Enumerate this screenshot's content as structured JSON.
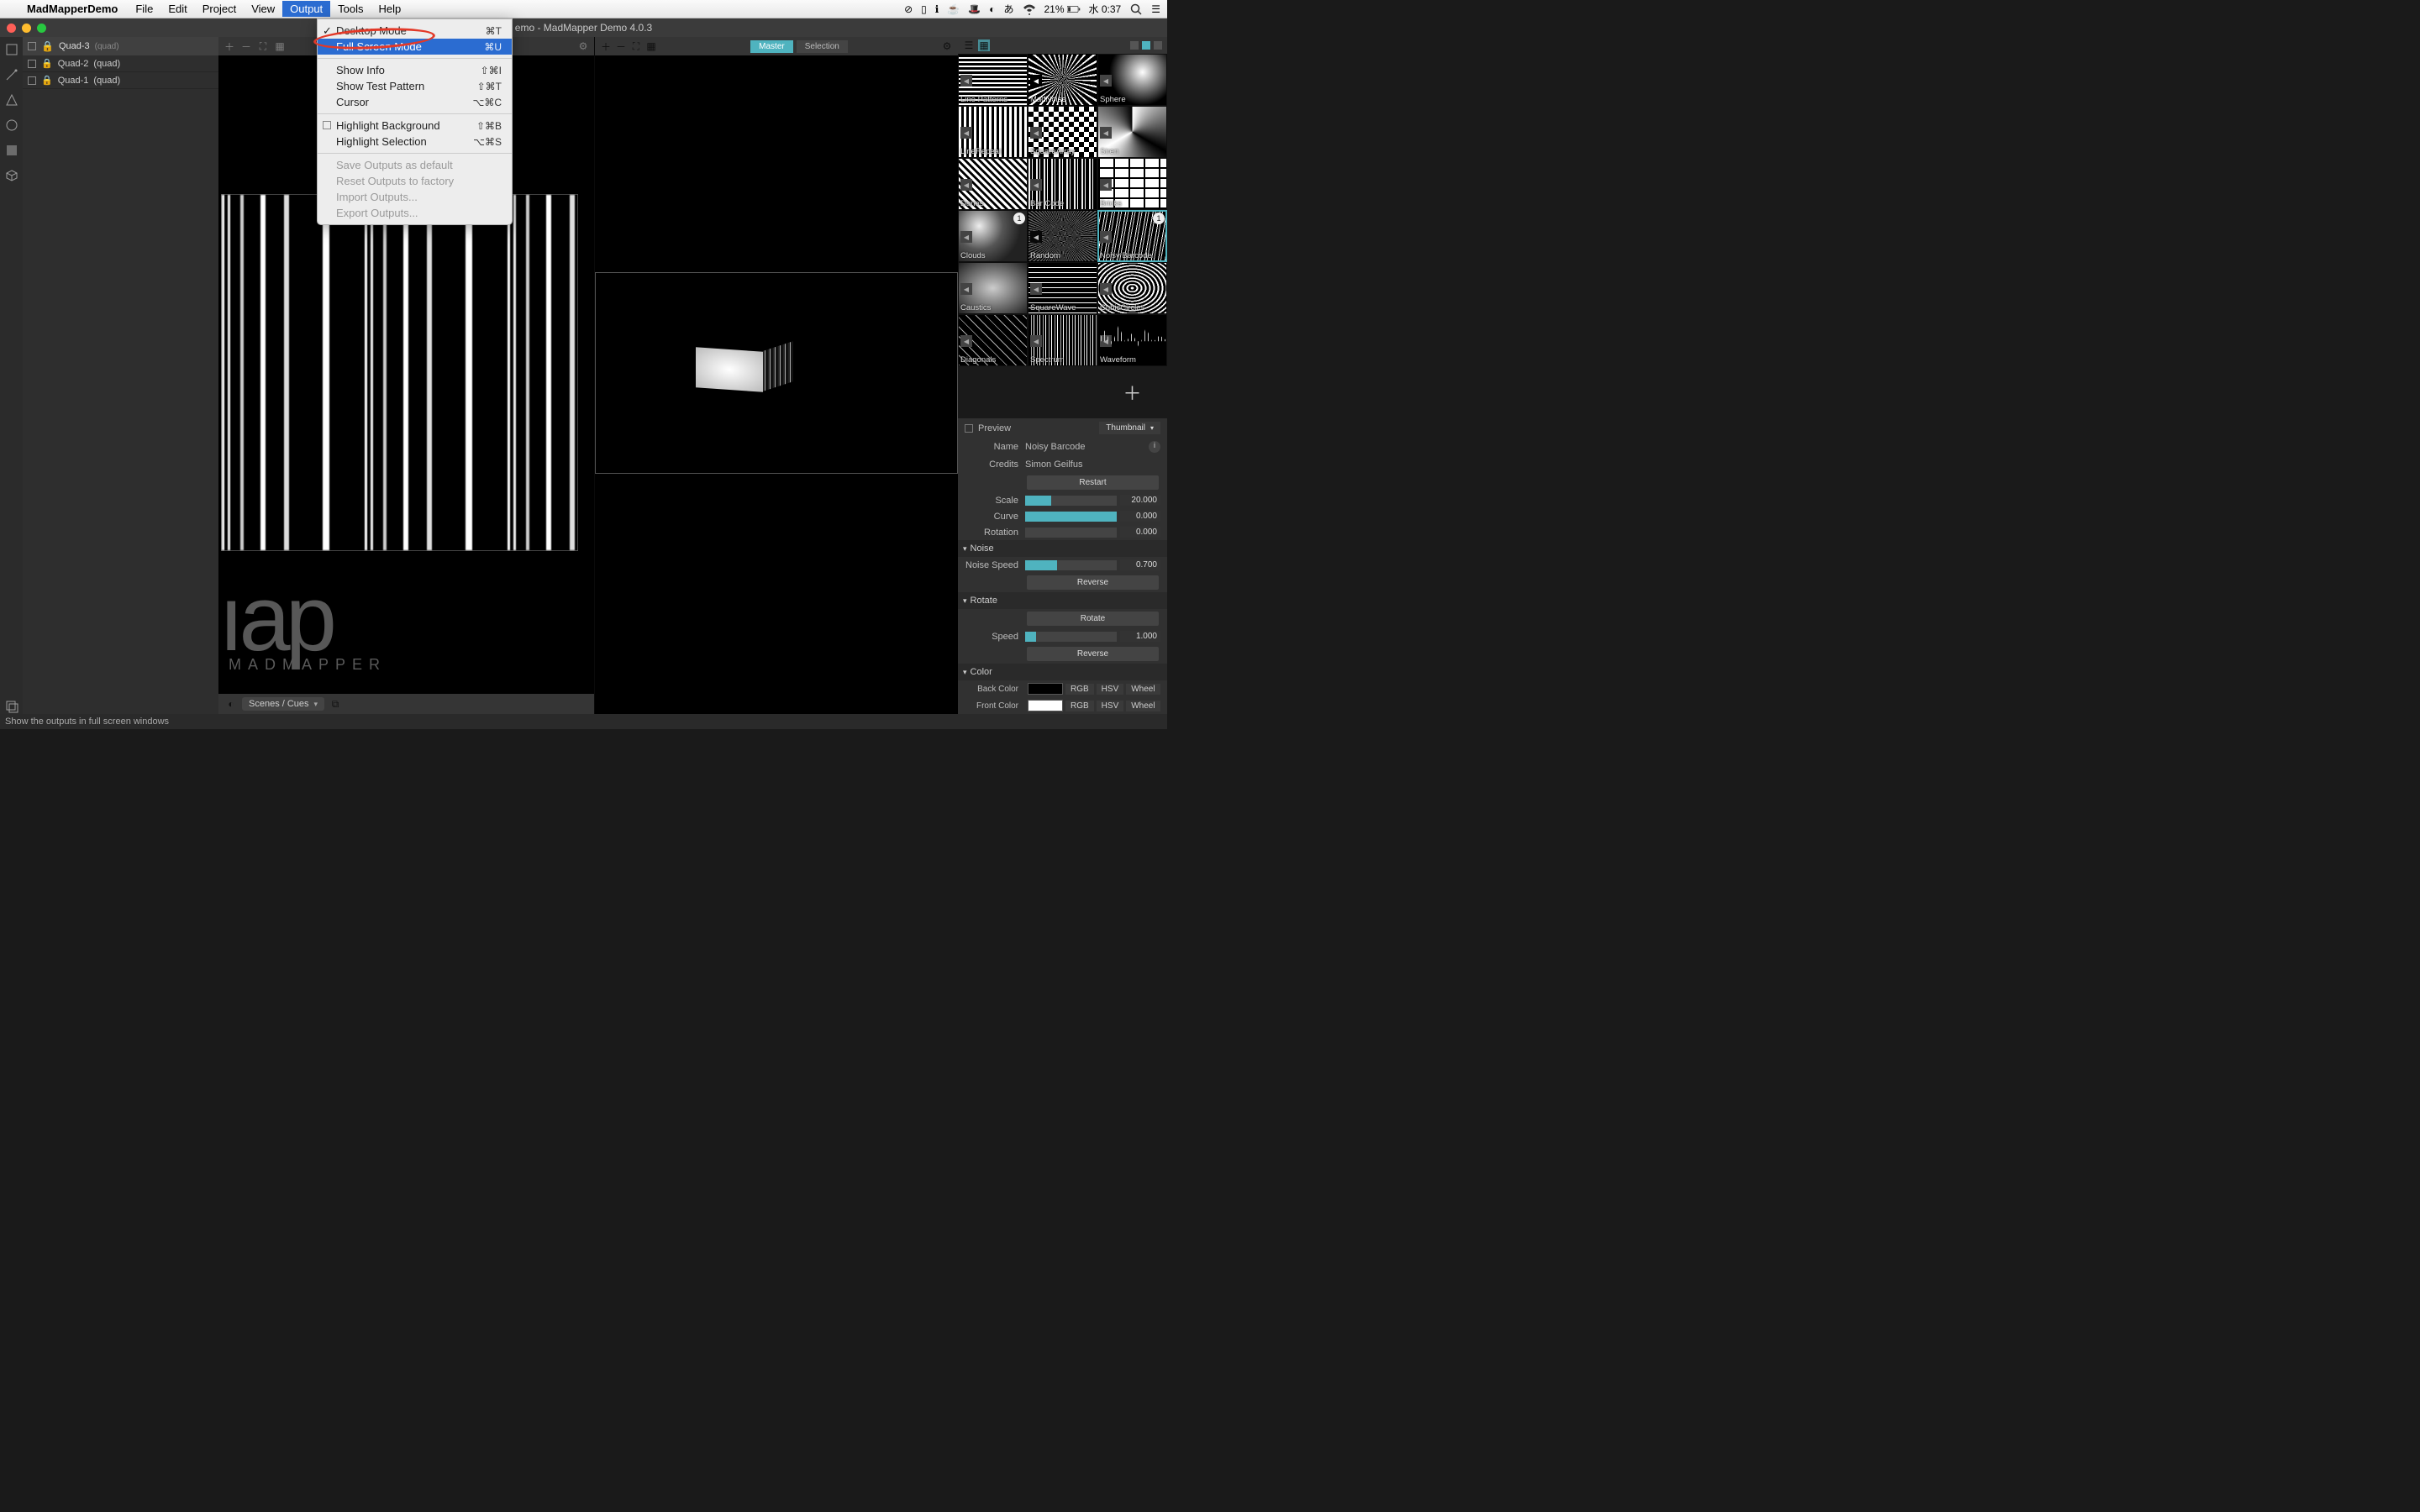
{
  "menubar": {
    "app": "MadMapperDemo",
    "items": [
      "File",
      "Edit",
      "Project",
      "View",
      "Output",
      "Tools",
      "Help"
    ],
    "open_index": 4,
    "right": {
      "battery": "21%",
      "clock": "水 0:37"
    }
  },
  "dropdown": {
    "groups": [
      [
        {
          "label": "Desktop Mode",
          "shortcut": "⌘T",
          "checked": true,
          "hover": false
        },
        {
          "label": "Full Screen Mode",
          "shortcut": "⌘U",
          "checked": false,
          "hover": true
        }
      ],
      [
        {
          "label": "Show Info",
          "shortcut": "⇧⌘I"
        },
        {
          "label": "Show Test Pattern",
          "shortcut": "⇧⌘T"
        },
        {
          "label": "Cursor",
          "shortcut": "⌥⌘C"
        }
      ],
      [
        {
          "label": "Highlight Background",
          "shortcut": "⇧⌘B",
          "box": true
        },
        {
          "label": "Highlight Selection",
          "shortcut": "⌥⌘S"
        }
      ],
      [
        {
          "label": "Save Outputs as default",
          "disabled": true
        },
        {
          "label": "Reset Outputs to factory",
          "disabled": true
        },
        {
          "label": "Import Outputs...",
          "disabled": true
        },
        {
          "label": "Export Outputs...",
          "disabled": true
        }
      ]
    ]
  },
  "titlebar": {
    "title": "emo - MadMapper Demo 4.0.3"
  },
  "surfaces": {
    "items": [
      {
        "name": "Quad-3",
        "type": "(quad)",
        "selected": true
      },
      {
        "name": "Quad-2",
        "type": "(quad)",
        "selected": false
      },
      {
        "name": "Quad-1",
        "type": "(quad)",
        "selected": false
      }
    ]
  },
  "master_tabs": {
    "master": "Master",
    "selection": "Selection"
  },
  "watermark": {
    "big": "ıap",
    "sub": "MADMAPPER"
  },
  "scenes_dd": "Scenes / Cues",
  "materials": {
    "items": [
      {
        "label": "Line Patterns",
        "tex": "tex-lines"
      },
      {
        "label": "MadNoise",
        "tex": "tex-noise"
      },
      {
        "label": "Sphere",
        "tex": "tex-sphere"
      },
      {
        "label": "LineRepeat",
        "tex": "tex-repeat"
      },
      {
        "label": "SquareArray",
        "tex": "tex-squares"
      },
      {
        "label": "Siren",
        "tex": "tex-siren"
      },
      {
        "label": "Dunes",
        "tex": "tex-dunes"
      },
      {
        "label": "Bar Code",
        "tex": "tex-barcode"
      },
      {
        "label": "Bricks",
        "tex": "tex-bricks"
      },
      {
        "label": "Clouds",
        "tex": "tex-clouds",
        "badge": "1"
      },
      {
        "label": "Random",
        "tex": "tex-random"
      },
      {
        "label": "Noisy Barcode",
        "tex": "tex-nbarcode",
        "selected": true,
        "badge": "1"
      },
      {
        "label": "Caustics",
        "tex": "tex-caustics"
      },
      {
        "label": "SquareWave",
        "tex": "tex-sqwave"
      },
      {
        "label": "CubicCircles",
        "tex": "tex-cubic"
      },
      {
        "label": "Diagonals",
        "tex": "tex-diag"
      },
      {
        "label": "Spectrum",
        "tex": "tex-spectrum"
      },
      {
        "label": "Waveform",
        "tex": "tex-waveform"
      }
    ]
  },
  "inspector": {
    "preview_label": "Preview",
    "thumb_mode": "Thumbnail",
    "name_label": "Name",
    "name_value": "Noisy Barcode",
    "credits_label": "Credits",
    "credits_value": "Simon Geilfus",
    "restart": "Restart",
    "sliders1": [
      {
        "label": "Scale",
        "value": "20.000",
        "fill": 28
      },
      {
        "label": "Curve",
        "value": "0.000",
        "fill": 100
      },
      {
        "label": "Rotation",
        "value": "0.000",
        "fill": 0
      }
    ],
    "noise_head": "Noise",
    "noise_slider": {
      "label": "Noise Speed",
      "value": "0.700",
      "fill": 35
    },
    "reverse": "Reverse",
    "rotate_head": "Rotate",
    "rotate_btn": "Rotate",
    "speed_slider": {
      "label": "Speed",
      "value": "1.000",
      "fill": 12
    },
    "color_head": "Color",
    "back_label": "Back Color",
    "front_label": "Front Color",
    "modes": [
      "RGB",
      "HSV",
      "Wheel"
    ]
  },
  "statusbar": "Show the outputs in full screen windows"
}
